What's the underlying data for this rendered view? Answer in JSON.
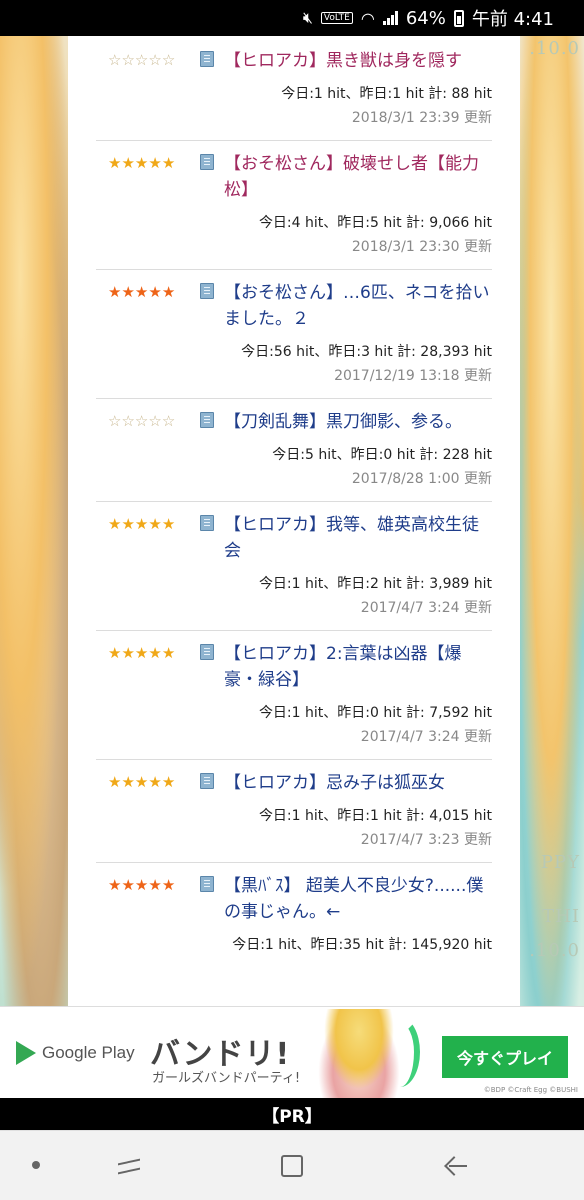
{
  "status_bar": {
    "volte": "VoLTE",
    "battery": "64%",
    "time": "午前 4:41"
  },
  "entries": [
    {
      "title": "【ヒロアカ】黒き獣は身を隠す",
      "title_color": "pink",
      "star_style": "empty",
      "hits": "今日:1 hit、昨日:1 hit 計: 88 hit",
      "updated": "2018/3/1 23:39 更新"
    },
    {
      "title": "【おそ松さん】破壊せし者【能力松】",
      "title_color": "pink",
      "star_style": "gold",
      "hits": "今日:4 hit、昨日:5 hit 計: 9,066 hit",
      "updated": "2018/3/1 23:30 更新"
    },
    {
      "title": "【おそ松さん】…6匹、ネコを拾いました。２",
      "title_color": "blue",
      "star_style": "orange",
      "hits": "今日:56 hit、昨日:3 hit 計: 28,393 hit",
      "updated": "2017/12/19 13:18 更新"
    },
    {
      "title": "【刀剣乱舞】黒刀御影、参る。",
      "title_color": "blue",
      "star_style": "empty",
      "hits": "今日:5 hit、昨日:0 hit 計: 228 hit",
      "updated": "2017/8/28 1:00 更新"
    },
    {
      "title": "【ヒロアカ】我等、雄英高校生徒会",
      "title_color": "blue",
      "star_style": "gold",
      "hits": "今日:1 hit、昨日:2 hit 計: 3,989 hit",
      "updated": "2017/4/7 3:24 更新"
    },
    {
      "title": "【ヒロアカ】2:言葉は凶器【爆豪・緑谷】",
      "title_color": "blue",
      "star_style": "gold",
      "hits": "今日:1 hit、昨日:0 hit 計: 7,592 hit",
      "updated": "2017/4/7 3:24 更新"
    },
    {
      "title": "【ヒロアカ】忌み子は狐巫女",
      "title_color": "blue",
      "star_style": "gold",
      "hits": "今日:1 hit、昨日:1 hit 計: 4,015 hit",
      "updated": "2017/4/7 3:23 更新"
    },
    {
      "title": "【黒ﾊﾞｽ】 超美人不良少女?......僕の事じゃん。←",
      "title_color": "blue",
      "star_style": "orange",
      "hits": "今日:1 hit、昨日:35 hit 計: 145,920 hit",
      "updated": ""
    }
  ],
  "wallpaper": {
    "right_text_1": ".10.0",
    "right_text_2": "PPY",
    "right_text_3": "THI",
    "right_text_4": ".10.0"
  },
  "ad": {
    "store": "Google Play",
    "brand": "バンドリ!",
    "subtitle": "ガールズバンドパーティ!",
    "cta": "今すぐプレイ",
    "copyright": "©BDP ©Craft Egg ©BUSHI",
    "pr_label": "【PR】"
  },
  "colors": {
    "title_pink": "#a0285e",
    "title_blue": "#1f3d8a",
    "star_gold": "#f0a818",
    "star_orange": "#ee6418",
    "cta_green": "#22b14c"
  }
}
